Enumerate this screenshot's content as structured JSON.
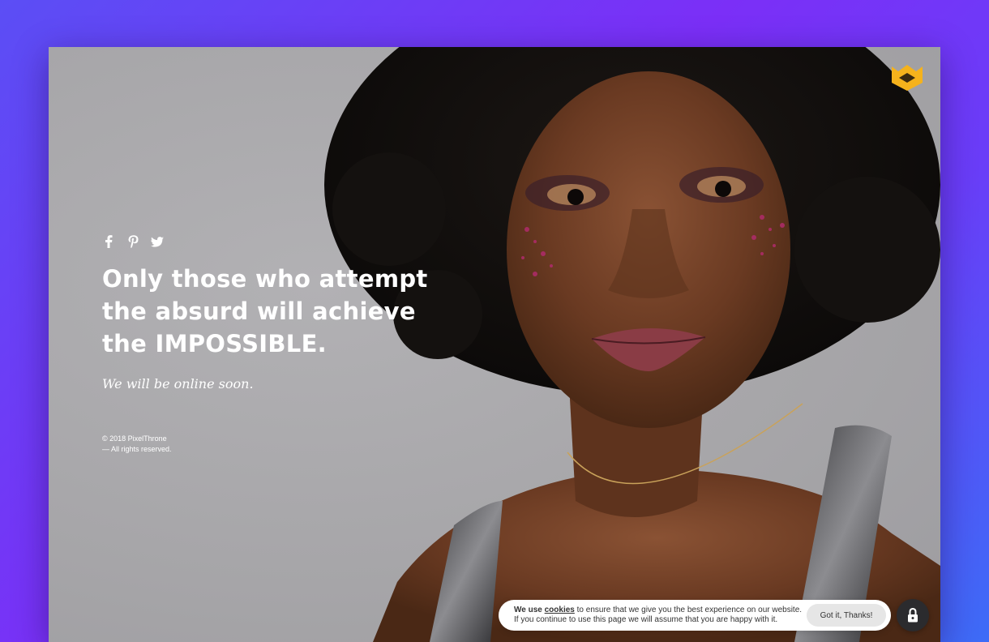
{
  "hero": {
    "headline": "Only those who attempt\nthe absurd will achieve\nthe IMPOSSIBLE.",
    "tagline": "We will be online soon.",
    "copyright_line1": "© 2018 PixelThrone",
    "copyright_line2": "— All rights reserved."
  },
  "social": {
    "icons": [
      "facebook-icon",
      "pinterest-icon",
      "twitter-icon"
    ]
  },
  "cookie": {
    "text_prefix": "We use",
    "link_label": "cookies",
    "text_suffix": "to ensure that we give you the best experience on our website.",
    "text_line2": "If you continue to use this page we will assume that you are happy with it.",
    "button_label": "Got it, Thanks!"
  },
  "colors": {
    "background_gradient_start": "#5b4ef5",
    "background_gradient_end": "#3d6cf7",
    "logo_accent": "#f5b21c",
    "text": "#ffffff"
  },
  "icons": {
    "logo": "crown-shield-logo-icon",
    "lock": "lock-icon"
  }
}
